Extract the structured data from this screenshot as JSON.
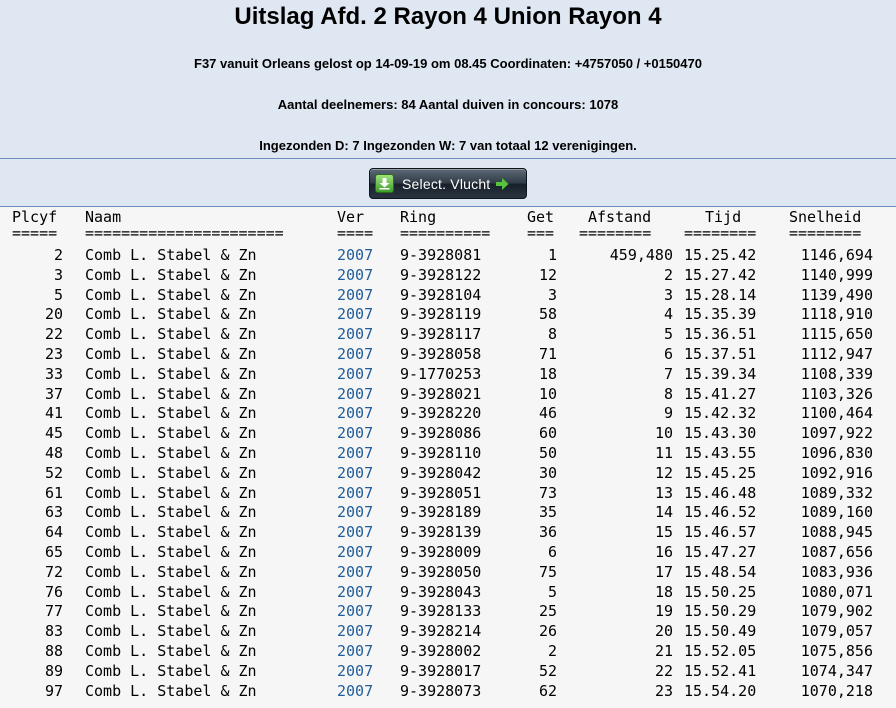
{
  "header": {
    "title": "Uitslag Afd. 2 Rayon 4 Union Rayon 4",
    "line1": "F37 vanuit Orleans gelost op 14-09-19 om 08.45 Coordinaten: +4757050 / +0150470",
    "line2": "Aantal deelnemers: 84 Aantal duiven in concours: 1078",
    "line3": "Ingezonden D: 7 Ingezonden W: 7 van totaal 12 verenigingen."
  },
  "toolbar": {
    "select_vlucht_label": "Select. Vlucht",
    "icon_left": "download-icon",
    "icon_right": "arrow-right-icon",
    "accent": "#3f9f2a"
  },
  "table": {
    "columns": [
      "Plcyf",
      "Naam",
      "Ver",
      "Ring",
      "Get",
      "Afstand",
      "Tijd",
      "Snelheid"
    ],
    "separators": [
      "=====",
      "======================",
      "====",
      "==========",
      "===",
      "========",
      "========",
      "========"
    ],
    "rows": [
      {
        "plc": "2",
        "naam": "Comb L. Stabel & Zn",
        "ver": "2007",
        "ring": "9-3928081",
        "get": "1",
        "afstand": "459,480",
        "tijd": "15.25.42",
        "snelheid": "1146,694"
      },
      {
        "plc": "3",
        "naam": "Comb L. Stabel & Zn",
        "ver": "2007",
        "ring": "9-3928122",
        "get": "12",
        "afstand": "2",
        "tijd": "15.27.42",
        "snelheid": "1140,999"
      },
      {
        "plc": "5",
        "naam": "Comb L. Stabel & Zn",
        "ver": "2007",
        "ring": "9-3928104",
        "get": "3",
        "afstand": "3",
        "tijd": "15.28.14",
        "snelheid": "1139,490"
      },
      {
        "plc": "20",
        "naam": "Comb L. Stabel & Zn",
        "ver": "2007",
        "ring": "9-3928119",
        "get": "58",
        "afstand": "4",
        "tijd": "15.35.39",
        "snelheid": "1118,910"
      },
      {
        "plc": "22",
        "naam": "Comb L. Stabel & Zn",
        "ver": "2007",
        "ring": "9-3928117",
        "get": "8",
        "afstand": "5",
        "tijd": "15.36.51",
        "snelheid": "1115,650"
      },
      {
        "plc": "23",
        "naam": "Comb L. Stabel & Zn",
        "ver": "2007",
        "ring": "9-3928058",
        "get": "71",
        "afstand": "6",
        "tijd": "15.37.51",
        "snelheid": "1112,947"
      },
      {
        "plc": "33",
        "naam": "Comb L. Stabel & Zn",
        "ver": "2007",
        "ring": "9-1770253",
        "get": "18",
        "afstand": "7",
        "tijd": "15.39.34",
        "snelheid": "1108,339"
      },
      {
        "plc": "37",
        "naam": "Comb L. Stabel & Zn",
        "ver": "2007",
        "ring": "9-3928021",
        "get": "10",
        "afstand": "8",
        "tijd": "15.41.27",
        "snelheid": "1103,326"
      },
      {
        "plc": "41",
        "naam": "Comb L. Stabel & Zn",
        "ver": "2007",
        "ring": "9-3928220",
        "get": "46",
        "afstand": "9",
        "tijd": "15.42.32",
        "snelheid": "1100,464"
      },
      {
        "plc": "45",
        "naam": "Comb L. Stabel & Zn",
        "ver": "2007",
        "ring": "9-3928086",
        "get": "60",
        "afstand": "10",
        "tijd": "15.43.30",
        "snelheid": "1097,922"
      },
      {
        "plc": "48",
        "naam": "Comb L. Stabel & Zn",
        "ver": "2007",
        "ring": "9-3928110",
        "get": "50",
        "afstand": "11",
        "tijd": "15.43.55",
        "snelheid": "1096,830"
      },
      {
        "plc": "52",
        "naam": "Comb L. Stabel & Zn",
        "ver": "2007",
        "ring": "9-3928042",
        "get": "30",
        "afstand": "12",
        "tijd": "15.45.25",
        "snelheid": "1092,916"
      },
      {
        "plc": "61",
        "naam": "Comb L. Stabel & Zn",
        "ver": "2007",
        "ring": "9-3928051",
        "get": "73",
        "afstand": "13",
        "tijd": "15.46.48",
        "snelheid": "1089,332"
      },
      {
        "plc": "63",
        "naam": "Comb L. Stabel & Zn",
        "ver": "2007",
        "ring": "9-3928189",
        "get": "35",
        "afstand": "14",
        "tijd": "15.46.52",
        "snelheid": "1089,160"
      },
      {
        "plc": "64",
        "naam": "Comb L. Stabel & Zn",
        "ver": "2007",
        "ring": "9-3928139",
        "get": "36",
        "afstand": "15",
        "tijd": "15.46.57",
        "snelheid": "1088,945"
      },
      {
        "plc": "65",
        "naam": "Comb L. Stabel & Zn",
        "ver": "2007",
        "ring": "9-3928009",
        "get": "6",
        "afstand": "16",
        "tijd": "15.47.27",
        "snelheid": "1087,656"
      },
      {
        "plc": "72",
        "naam": "Comb L. Stabel & Zn",
        "ver": "2007",
        "ring": "9-3928050",
        "get": "75",
        "afstand": "17",
        "tijd": "15.48.54",
        "snelheid": "1083,936"
      },
      {
        "plc": "76",
        "naam": "Comb L. Stabel & Zn",
        "ver": "2007",
        "ring": "9-3928043",
        "get": "5",
        "afstand": "18",
        "tijd": "15.50.25",
        "snelheid": "1080,071"
      },
      {
        "plc": "77",
        "naam": "Comb L. Stabel & Zn",
        "ver": "2007",
        "ring": "9-3928133",
        "get": "25",
        "afstand": "19",
        "tijd": "15.50.29",
        "snelheid": "1079,902"
      },
      {
        "plc": "83",
        "naam": "Comb L. Stabel & Zn",
        "ver": "2007",
        "ring": "9-3928214",
        "get": "26",
        "afstand": "20",
        "tijd": "15.50.49",
        "snelheid": "1079,057"
      },
      {
        "plc": "88",
        "naam": "Comb L. Stabel & Zn",
        "ver": "2007",
        "ring": "9-3928002",
        "get": "2",
        "afstand": "21",
        "tijd": "15.52.05",
        "snelheid": "1075,856"
      },
      {
        "plc": "89",
        "naam": "Comb L. Stabel & Zn",
        "ver": "2007",
        "ring": "9-3928017",
        "get": "52",
        "afstand": "22",
        "tijd": "15.52.41",
        "snelheid": "1074,347"
      },
      {
        "plc": "97",
        "naam": "Comb L. Stabel & Zn",
        "ver": "2007",
        "ring": "9-3928073",
        "get": "62",
        "afstand": "23",
        "tijd": "15.54.20",
        "snelheid": "1070,218"
      }
    ]
  }
}
